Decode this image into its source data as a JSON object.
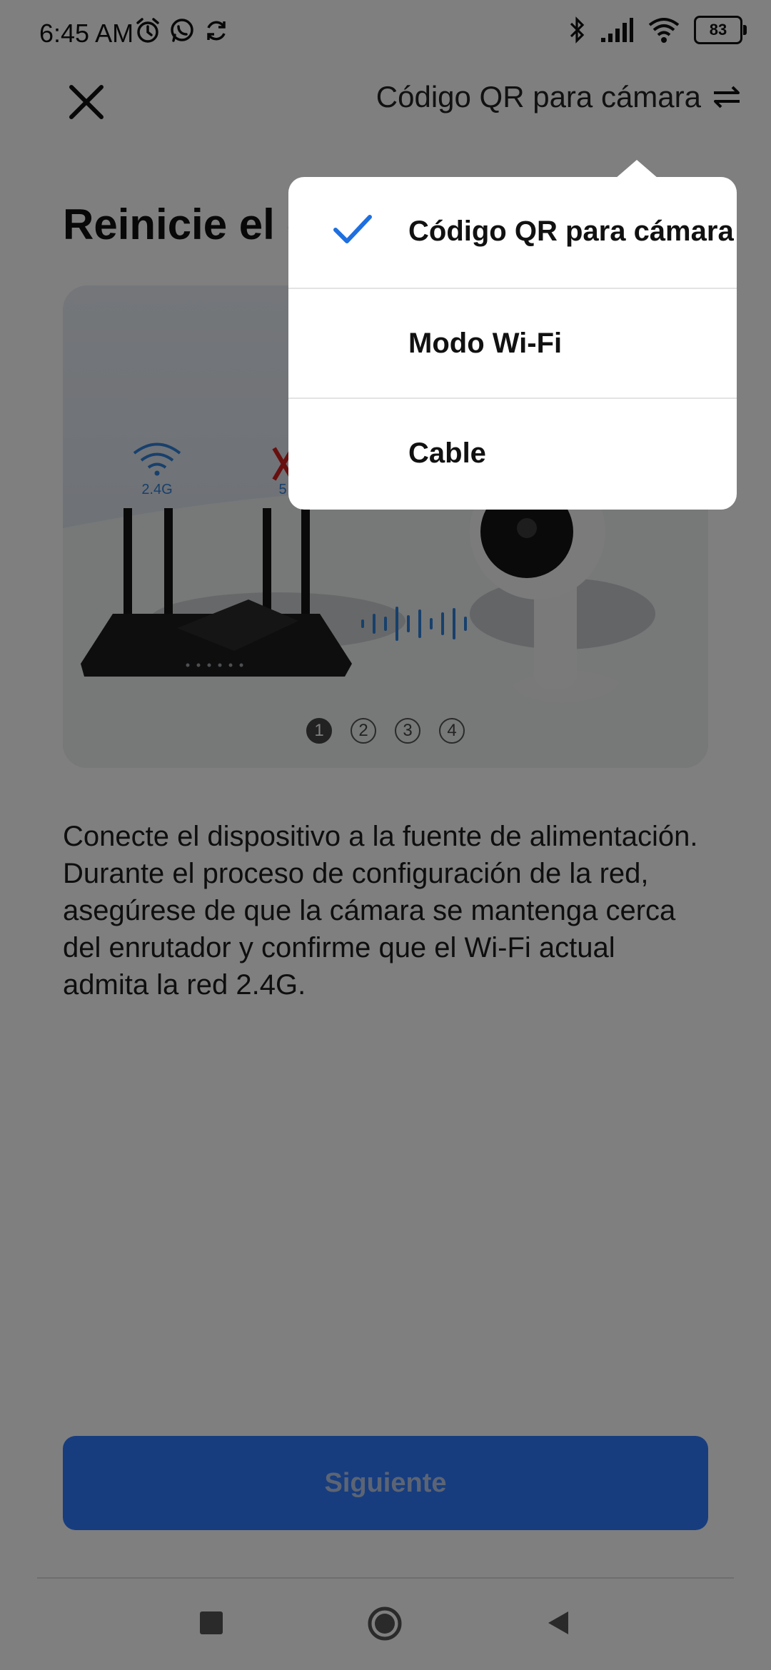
{
  "status_bar": {
    "time": "6:45 AM",
    "battery": "83",
    "icons": [
      "alarm-icon",
      "whatsapp-icon",
      "sync-icon",
      "bluetooth-icon",
      "signal-icon",
      "wifi-icon",
      "battery-icon"
    ]
  },
  "header": {
    "mode_label": "Código QR para cámara"
  },
  "page": {
    "title": "Reinicie el c",
    "description": "Conecte el dispositivo a la fuente de alimentación. Durante el proceso de configuración de la red, asegúrese de que la cámara se mantenga cerca del enrutador y confirme que el Wi-Fi actual admita la red 2.4G.",
    "next_button": "Siguiente"
  },
  "illustration": {
    "band_24": "2.4G",
    "band_5": "5",
    "pages": [
      "1",
      "2",
      "3",
      "4"
    ],
    "active_page": "1"
  },
  "menu": {
    "items": [
      {
        "label": "Código QR para cámara",
        "selected": true
      },
      {
        "label": "Modo Wi-Fi",
        "selected": false
      },
      {
        "label": "Cable",
        "selected": false
      }
    ]
  },
  "colors": {
    "accent": "#2f7bff",
    "check": "#1e6fe0",
    "overlay": "rgba(0,0,0,0.5)"
  }
}
